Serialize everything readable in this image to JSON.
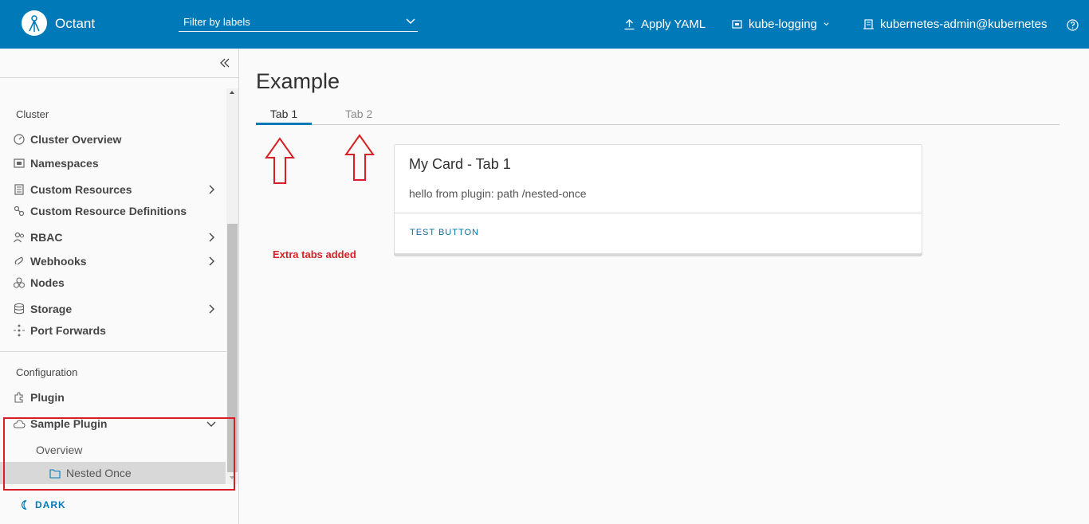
{
  "header": {
    "brand": "Octant",
    "filter_placeholder": "Filter by labels",
    "apply_yaml": "Apply YAML",
    "namespace": "kube-logging",
    "context": "kubernetes-admin@kubernetes",
    "icons": {
      "logo": "octant-logo",
      "apply": "upload-icon",
      "namespace": "namespace-icon",
      "context": "building-icon",
      "help": "help-icon"
    },
    "accent": "#0079b8"
  },
  "sidebar": {
    "sections": {
      "cluster": "Cluster",
      "configuration": "Configuration"
    },
    "cluster_items": [
      {
        "label": "Cluster Overview",
        "icon": "dashboard-icon"
      },
      {
        "label": "Namespaces",
        "icon": "namespace-icon"
      },
      {
        "label": "Custom Resources",
        "icon": "list-icon",
        "expandable": true
      },
      {
        "label": "Custom Resource Definitions",
        "icon": "crd-icon"
      },
      {
        "label": "RBAC",
        "icon": "users-icon",
        "expandable": true
      },
      {
        "label": "Webhooks",
        "icon": "hook-icon",
        "expandable": true
      },
      {
        "label": "Nodes",
        "icon": "nodes-icon"
      },
      {
        "label": "Storage",
        "icon": "storage-icon",
        "expandable": true
      },
      {
        "label": "Port Forwards",
        "icon": "port-forward-icon"
      }
    ],
    "configuration_items": [
      {
        "label": "Plugin",
        "icon": "plugin-icon"
      },
      {
        "label": "Sample Plugin",
        "icon": "cloud-icon",
        "expanded": true
      }
    ],
    "sub_items": {
      "overview": "Overview",
      "nested_once": "Nested Once"
    },
    "dark_toggle": "DARK"
  },
  "main": {
    "title": "Example",
    "tabs": [
      {
        "label": "Tab 1",
        "active": true
      },
      {
        "label": "Tab 2",
        "active": false
      }
    ],
    "annotation": "Extra tabs added",
    "annotation_color": "#d91f26",
    "card": {
      "title": "My Card - Tab 1",
      "body": "hello from plugin: path /nested-once",
      "button": "TEST BUTTON"
    }
  }
}
